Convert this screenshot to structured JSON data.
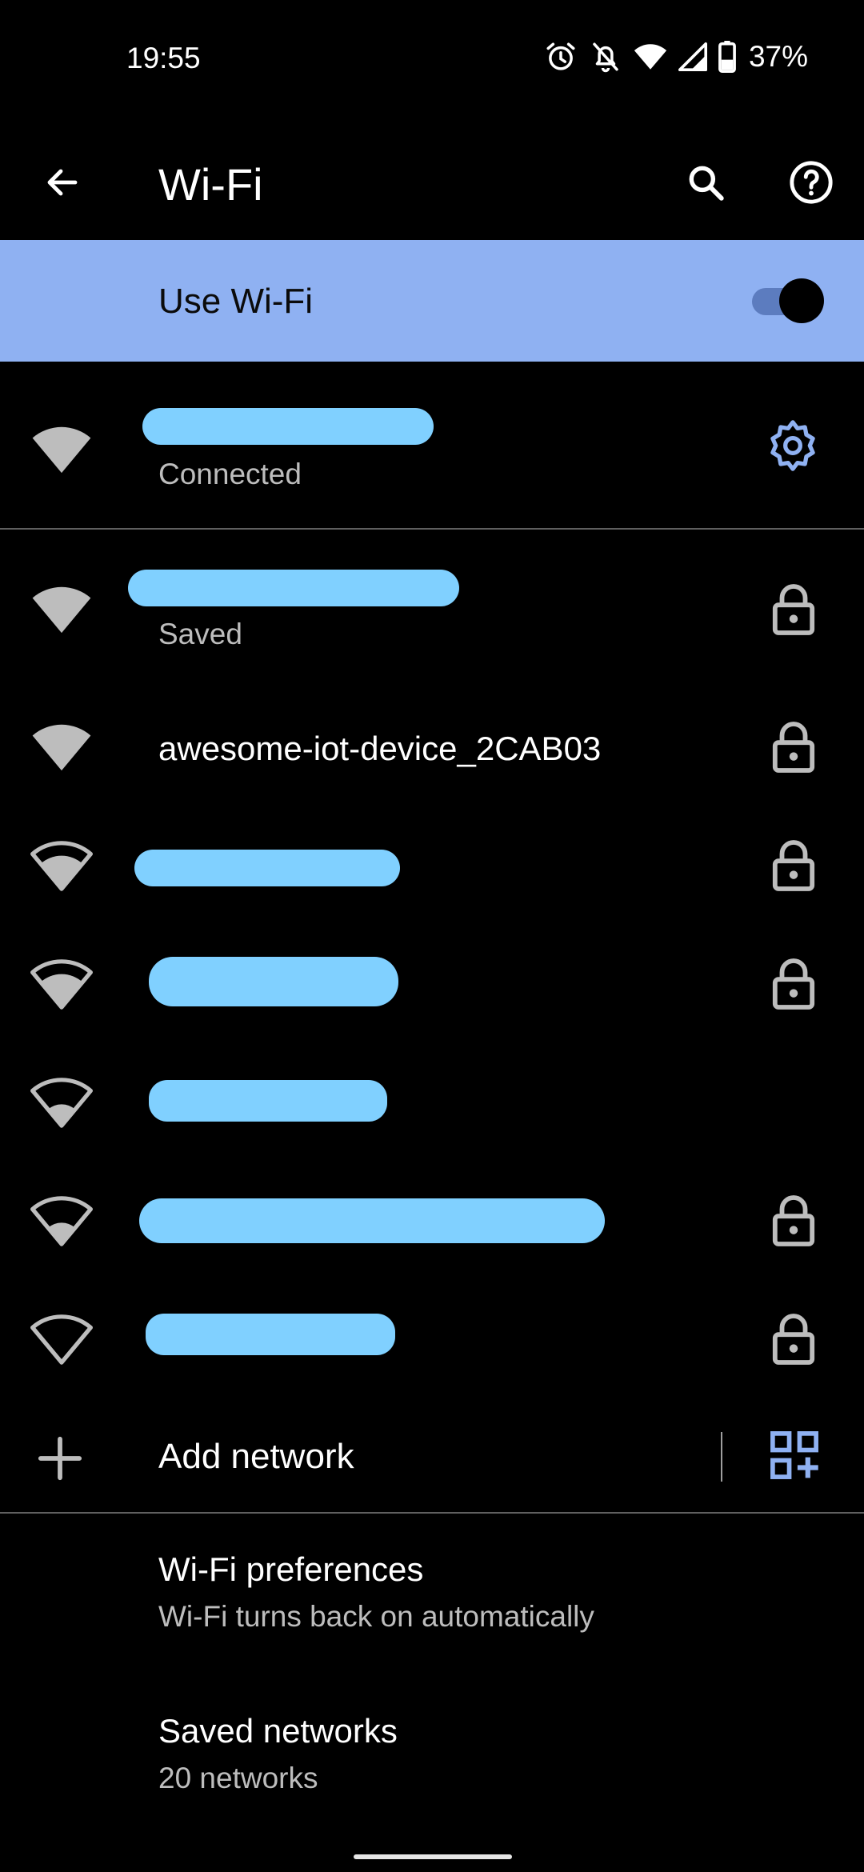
{
  "status_bar": {
    "time": "19:55",
    "battery_percent": "37%",
    "icons": [
      "alarm-icon",
      "bell-off-icon",
      "wifi-icon",
      "signal-icon",
      "battery-icon"
    ]
  },
  "toolbar": {
    "title": "Wi-Fi",
    "back_icon": "arrow-back-icon",
    "search_icon": "search-icon",
    "help_icon": "help-icon"
  },
  "master_switch": {
    "label": "Use Wi-Fi",
    "on": true,
    "color": "#8fb1f2"
  },
  "connected_network": {
    "ssid_redacted": true,
    "status": "Connected",
    "signal_bars": 4,
    "settings_icon": "gear-icon"
  },
  "networks": [
    {
      "ssid": "",
      "ssid_redacted": true,
      "status": "Saved",
      "signal_bars": 4,
      "locked": true
    },
    {
      "ssid": "awesome-iot-device_2CAB03",
      "ssid_redacted": false,
      "status": "",
      "signal_bars": 4,
      "locked": true
    },
    {
      "ssid": "",
      "ssid_redacted": true,
      "status": "",
      "signal_bars": 3,
      "locked": true
    },
    {
      "ssid": "",
      "ssid_redacted": true,
      "status": "",
      "signal_bars": 3,
      "locked": true
    },
    {
      "ssid": "",
      "ssid_redacted": true,
      "status": "",
      "signal_bars": 2,
      "locked": false
    },
    {
      "ssid": "",
      "ssid_redacted": true,
      "status": "",
      "signal_bars": 2,
      "locked": true
    },
    {
      "ssid": "",
      "ssid_redacted": true,
      "status": "",
      "signal_bars": 1,
      "locked": true
    }
  ],
  "add_network": {
    "label": "Add network",
    "add_icon": "plus-icon",
    "qr_icon": "qr-code-scanner-icon"
  },
  "preferences": [
    {
      "title": "Wi-Fi preferences",
      "subtitle": "Wi-Fi turns back on automatically"
    },
    {
      "title": "Saved networks",
      "subtitle": "20 networks"
    }
  ],
  "colors": {
    "accent": "#8fb1f2",
    "redaction": "#80d0ff",
    "background": "#000000"
  }
}
